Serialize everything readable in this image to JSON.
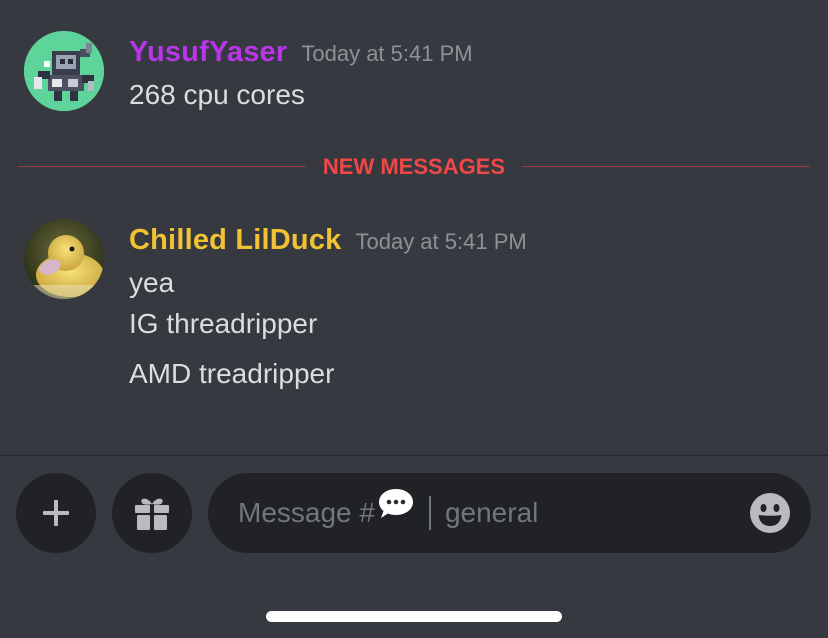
{
  "colors": {
    "background": "#36393f",
    "username_yusuf": "#b836e8",
    "username_duck": "#f1c232",
    "new_messages": "#f04747",
    "timestamp": "#8e9297",
    "text": "#dcddde",
    "input_bg": "#202225"
  },
  "messages": [
    {
      "username": "YusufYaser",
      "timestamp": "Today at 5:41 PM",
      "avatar_icon": "pixel-robot-avatar",
      "lines": [
        "268 cpu cores"
      ]
    },
    {
      "username": "Chilled LilDuck",
      "timestamp": "Today at 5:41 PM",
      "avatar_icon": "duckling-avatar",
      "lines": [
        "yea",
        "IG threadripper",
        "AMD treadripper"
      ]
    }
  ],
  "divider": {
    "label": "NEW MESSAGES"
  },
  "composer": {
    "add_icon": "plus-icon",
    "gift_icon": "gift-icon",
    "placeholder_prefix": "Message #",
    "channel_emoji": "speech-bubble-icon",
    "channel_name": "general",
    "emoji_icon": "smiley-icon"
  }
}
